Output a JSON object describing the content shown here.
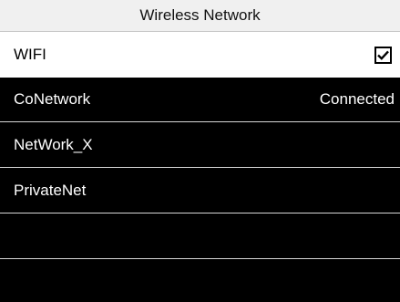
{
  "title": "Wireless Network",
  "wifi": {
    "label": "WIFI",
    "checked": true,
    "icon": "checkbox-checked-icon"
  },
  "networks": [
    {
      "name": "CoNetwork",
      "status": "Connected"
    },
    {
      "name": "NetWork_X",
      "status": ""
    },
    {
      "name": "PrivateNet",
      "status": ""
    },
    {
      "name": "",
      "status": ""
    },
    {
      "name": "",
      "status": ""
    }
  ],
  "colors": {
    "title_bg": "#f0f0f0",
    "list_bg": "#000000",
    "wifi_row_bg": "#ffffff",
    "separator": "#d6d6d6",
    "text_light": "#ffffff",
    "text_dark": "#000000"
  }
}
